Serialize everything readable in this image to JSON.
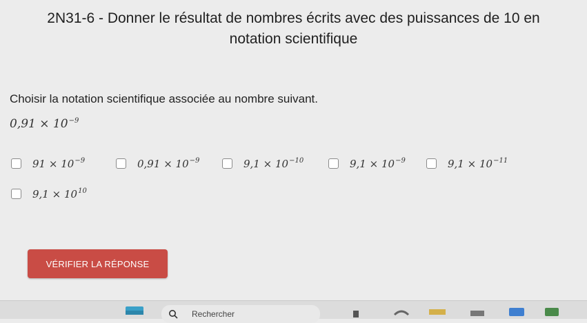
{
  "title": {
    "line1": "2N31-6 - Donner le résultat de nombres écrits avec des puissances de 10 en",
    "line2": "notation scientifique"
  },
  "question": "Choisir la notation scientifique associée au nombre suivant.",
  "given": {
    "mantissa": "0,91",
    "times": "×",
    "base": "10",
    "exp": "−9"
  },
  "options": [
    {
      "mantissa": "91",
      "times": "×",
      "base": "10",
      "exp": "−9"
    },
    {
      "mantissa": "0,91",
      "times": "×",
      "base": "10",
      "exp": "−9"
    },
    {
      "mantissa": "9,1",
      "times": "×",
      "base": "10",
      "exp": "−10"
    },
    {
      "mantissa": "9,1",
      "times": "×",
      "base": "10",
      "exp": "−9"
    },
    {
      "mantissa": "9,1",
      "times": "×",
      "base": "10",
      "exp": "−11"
    },
    {
      "mantissa": "9,1",
      "times": "×",
      "base": "10",
      "exp": "10"
    }
  ],
  "button": {
    "label": "VÉRIFIER LA RÉPONSE",
    "color": "#c94c45"
  },
  "taskbar": {
    "search_label": "Rechercher"
  },
  "icons": [
    "checkbox",
    "search-icon",
    "widgets-icon"
  ]
}
